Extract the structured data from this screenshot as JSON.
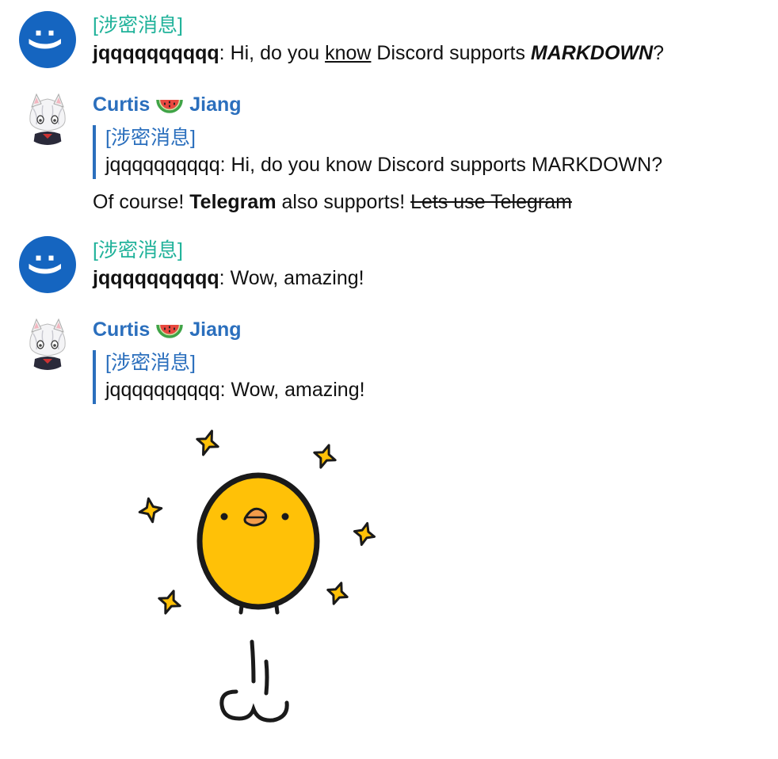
{
  "messages": [
    {
      "type": "bot",
      "avatar_text": ":)",
      "sender": "[涉密消息]",
      "text": {
        "author": "jqqqqqqqqqq",
        "sep": ": ",
        "part1": "Hi, do you ",
        "underlined": "know",
        "part2": " Discord supports ",
        "bold_italic": "MARKDOWN",
        "part3": "?"
      }
    },
    {
      "type": "user",
      "sender_first": "Curtis",
      "sender_emoji": "watermelon-icon",
      "sender_last": "Jiang",
      "quote": {
        "name": "[涉密消息]",
        "text": "jqqqqqqqqqq: Hi, do you know Discord supports MARKDOWN?"
      },
      "reply": {
        "part1": "Of course! ",
        "bold": "Telegram",
        "part2": " also supports! ",
        "strike": "Lets use Telegram"
      }
    },
    {
      "type": "bot",
      "avatar_text": ":)",
      "sender": "[涉密消息]",
      "text": {
        "author": "jqqqqqqqqqq",
        "sep": ": ",
        "part1": "Wow, amazing!"
      }
    },
    {
      "type": "user",
      "sender_first": "Curtis",
      "sender_emoji": "watermelon-icon",
      "sender_last": "Jiang",
      "quote": {
        "name": "[涉密消息]",
        "text": "jqqqqqqqqqq: Wow, amazing!"
      },
      "sticker": "yellow-chick-sticker"
    }
  ],
  "colors": {
    "bot_avatar_bg": "#1565c0",
    "bot_name": "#20b29a",
    "user_name": "#2b6fbd",
    "quote_bar": "#2b6fbd",
    "chick_yellow": "#ffc107",
    "sparkle_yellow": "#ffc107"
  }
}
